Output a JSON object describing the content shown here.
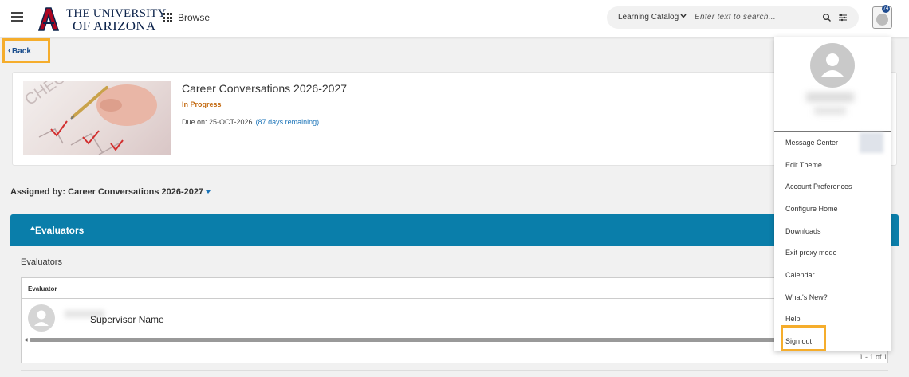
{
  "header": {
    "logo_line1": "THE UNIVERSITY",
    "logo_line2": "OF ARIZONA",
    "browse_label": "Browse",
    "search_scope": "Learning Catalog",
    "search_placeholder": "Enter text to search...",
    "notification_count": "74"
  },
  "back_label": "Back",
  "course": {
    "title": "Career Conversations 2026-2027",
    "status": "In Progress",
    "due_text": "Due on: 25-OCT-2026",
    "remaining_text": "(87 days remaining)"
  },
  "assigned_by": "Assigned by: Career Conversations 2026-2027",
  "evaluators": {
    "section_title": "Evaluators",
    "subheading": "Evaluators",
    "column_header": "Evaluator",
    "rows": [
      {
        "name": "Supervisor Name"
      }
    ],
    "pager": "1 - 1 of 1"
  },
  "menu": {
    "items": [
      "Message Center",
      "Edit Theme",
      "Account Preferences",
      "Configure Home",
      "Downloads",
      "Exit proxy mode",
      "Calendar",
      "What's New?",
      "Help",
      "Sign out"
    ]
  },
  "colors": {
    "accent": "#0a7eaa",
    "highlight": "#f5ad2c",
    "status": "#c46b12",
    "link": "#1a73b8",
    "brand": "#ab0520"
  }
}
